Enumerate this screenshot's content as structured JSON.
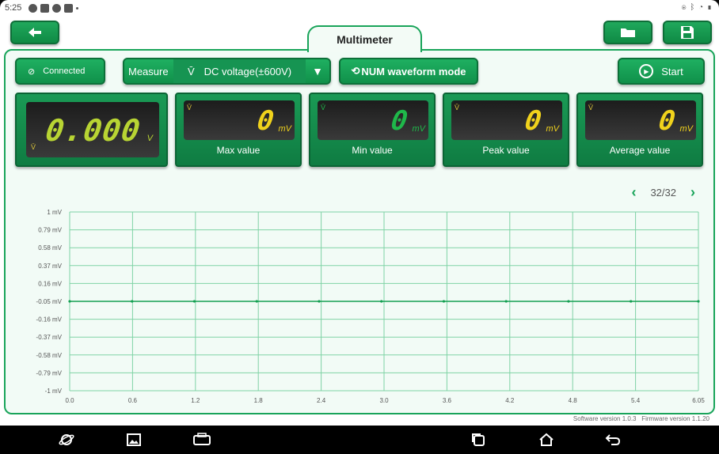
{
  "status_bar": {
    "time": "5:25"
  },
  "app": {
    "title": "Multimeter"
  },
  "toolbar": {
    "connected_label": "Connected",
    "measure_label": "Measure",
    "measure_value": "DC voltage(±600V)",
    "mode_label": "NUM waveform mode",
    "start_label": "Start"
  },
  "main_display": {
    "value": "0.000",
    "unit": "V"
  },
  "cards": [
    {
      "label": "Max value",
      "value": "0",
      "unit": "mV",
      "color": "#f0d21c"
    },
    {
      "label": "Min value",
      "value": "0",
      "unit": "mV",
      "color": "#1fb84a"
    },
    {
      "label": "Peak value",
      "value": "0",
      "unit": "mV",
      "color": "#f0d21c"
    },
    {
      "label": "Average value",
      "value": "0",
      "unit": "mV",
      "color": "#f0d21c"
    }
  ],
  "pager": {
    "text": "32/32"
  },
  "colors": {
    "accent": "#19a45a",
    "lcd_digit_yellow": "#f0d21c",
    "lcd_digit_green": "#1fb84a",
    "main_digit": "#b8d433"
  },
  "chart_data": {
    "type": "line",
    "y_ticks": [
      "1 mV",
      "0.79 mV",
      "0.58 mV",
      "0.37 mV",
      "0.16 mV",
      "-0.05 mV",
      "-0.16 mV",
      "-0.37 mV",
      "-0.58 mV",
      "-0.79 mV",
      "-1 mV"
    ],
    "x_ticks": [
      "0.0",
      "0.6",
      "1.2",
      "1.8",
      "2.4",
      "3.0",
      "3.6",
      "4.2",
      "4.8",
      "5.4",
      "6.05"
    ],
    "x": [
      0.0,
      0.6,
      1.2,
      1.8,
      2.4,
      3.0,
      3.6,
      4.2,
      4.8,
      5.4,
      6.05
    ],
    "y": [
      -0.05,
      -0.05,
      -0.05,
      -0.05,
      -0.05,
      -0.05,
      -0.05,
      -0.05,
      -0.05,
      -0.05,
      -0.05
    ],
    "grid": true
  },
  "footer": {
    "software": "Software version 1.0.3",
    "firmware": "Firmware version 1.1.20"
  }
}
